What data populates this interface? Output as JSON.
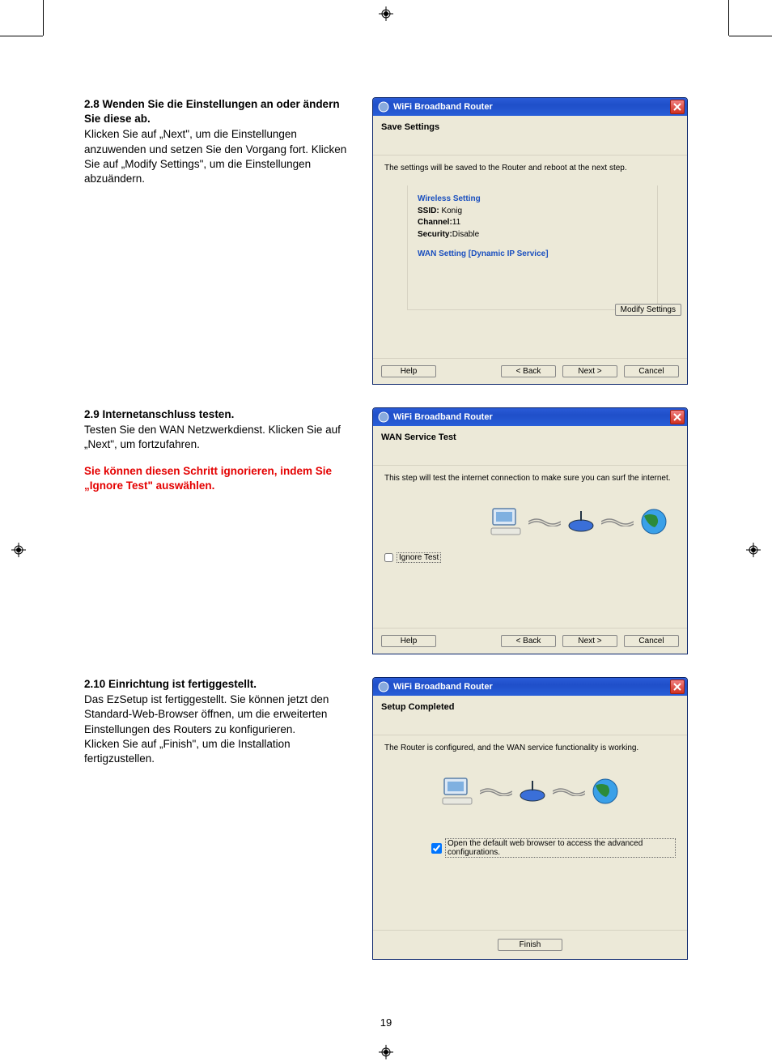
{
  "page_number": "19",
  "section28": {
    "heading": "2.8 Wenden Sie die Einstellungen an oder ändern Sie diese ab.",
    "body": "Klicken Sie auf „Next\", um die Einstellungen anzuwenden und setzen Sie den Vorgang fort. Klicken Sie auf „Modify Settings\", um die Einstellungen abzuändern."
  },
  "section29": {
    "heading": "2.9 Internetanschluss testen.",
    "body": "Testen Sie den WAN Netzwerkdienst. Klicken Sie auf „Next\", um fortzufahren.",
    "red": "Sie können diesen Schritt ignorieren, indem Sie „Ignore Test\" auswählen."
  },
  "section210": {
    "heading": "2.10 Einrichtung ist fertiggestellt.",
    "body": "Das EzSetup ist fertiggestellt. Sie können jetzt den Standard-Web-Browser öffnen, um die erweiterten Einstellungen des Routers zu konfigurieren.\nKlicken Sie auf „Finish\", um die Installation fertigzustellen."
  },
  "dialog1": {
    "title": "WiFi Broadband Router",
    "section": "Save Settings",
    "msg": "The settings will be saved to the Router and reboot at the next step.",
    "wireless_hdr": "Wireless Setting",
    "ssid_label": "SSID:",
    "ssid_value": "Konig",
    "channel_label": "Channel:",
    "channel_value": "11",
    "security_label": "Security:",
    "security_value": "Disable",
    "wan_hdr": "WAN Setting  [Dynamic IP Service]",
    "modify": "Modify Settings",
    "help": "Help",
    "back": "< Back",
    "next": "Next >",
    "cancel": "Cancel"
  },
  "dialog2": {
    "title": "WiFi Broadband Router",
    "section": "WAN Service Test",
    "msg": "This step will test the internet connection to make sure you can surf the internet.",
    "ignore": "Ignore Test",
    "help": "Help",
    "back": "< Back",
    "next": "Next >",
    "cancel": "Cancel"
  },
  "dialog3": {
    "title": "WiFi Broadband Router",
    "section": "Setup Completed",
    "msg": "The Router is configured, and the WAN service functionality is working.",
    "open_browser": "Open the default web browser to access the advanced configurations.",
    "finish": "Finish"
  }
}
